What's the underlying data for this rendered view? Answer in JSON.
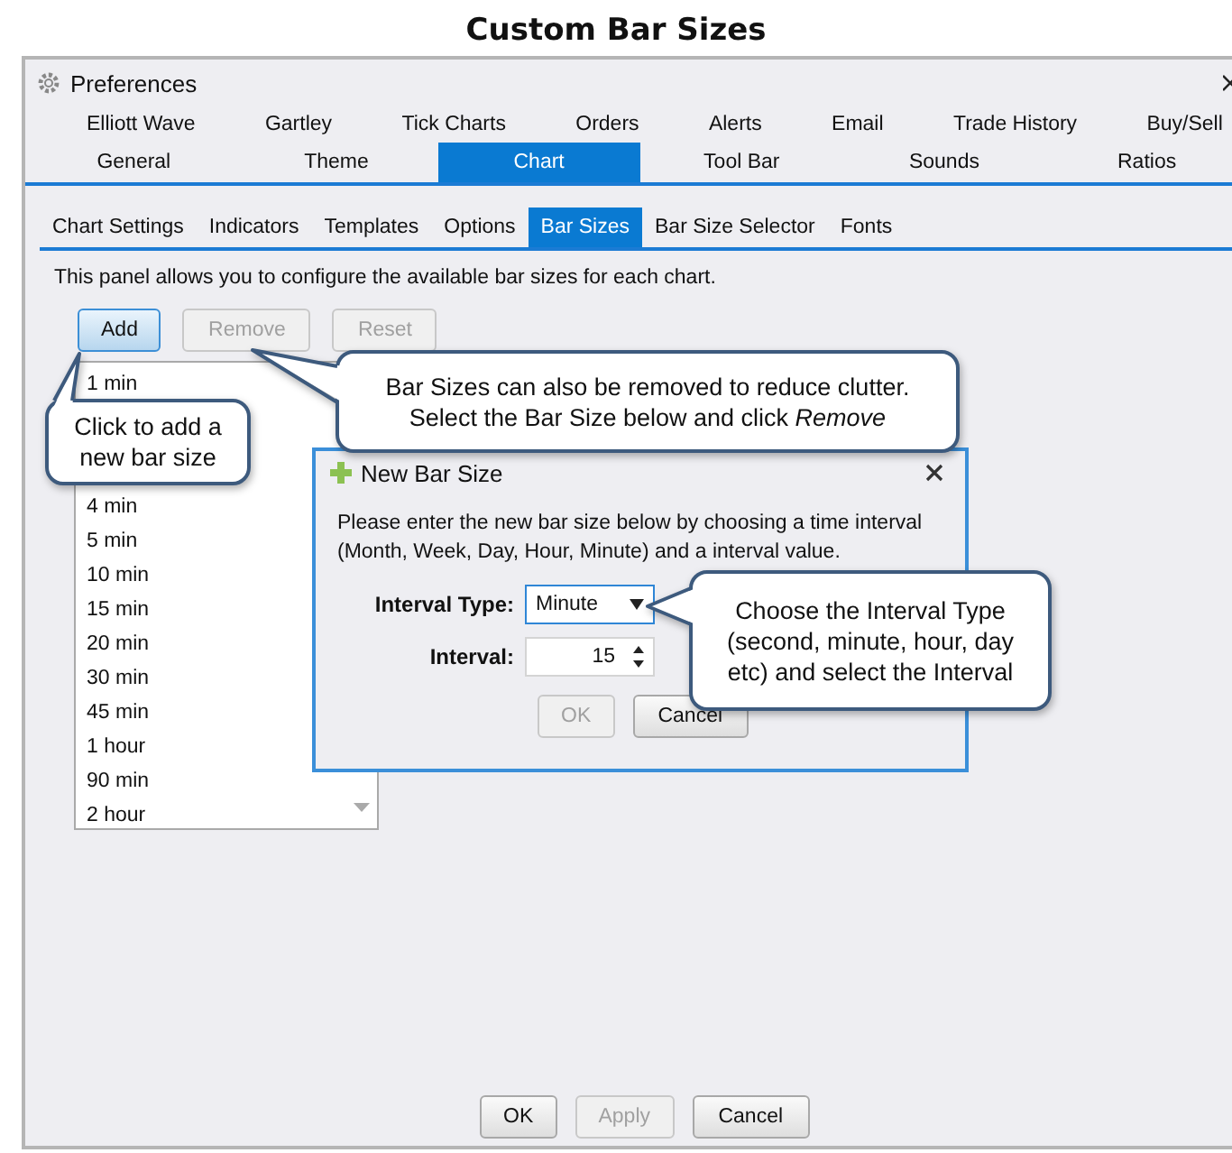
{
  "page_title": "Custom Bar Sizes",
  "window": {
    "title": "Preferences"
  },
  "tabs_row_1": [
    {
      "label": "Elliott Wave",
      "selected": false
    },
    {
      "label": "Gartley",
      "selected": false
    },
    {
      "label": "Tick Charts",
      "selected": false
    },
    {
      "label": "Orders",
      "selected": false
    },
    {
      "label": "Alerts",
      "selected": false
    },
    {
      "label": "Email",
      "selected": false
    },
    {
      "label": "Trade History",
      "selected": false
    },
    {
      "label": "Buy/Sell",
      "selected": false
    }
  ],
  "tabs_row_2": [
    {
      "label": "General",
      "selected": false
    },
    {
      "label": "Theme",
      "selected": false
    },
    {
      "label": "Chart",
      "selected": true
    },
    {
      "label": "Tool Bar",
      "selected": false
    },
    {
      "label": "Sounds",
      "selected": false
    },
    {
      "label": "Ratios",
      "selected": false
    }
  ],
  "subtabs": [
    {
      "label": "Chart Settings",
      "selected": false
    },
    {
      "label": "Indicators",
      "selected": false
    },
    {
      "label": "Templates",
      "selected": false
    },
    {
      "label": "Options",
      "selected": false
    },
    {
      "label": "Bar Sizes",
      "selected": true
    },
    {
      "label": "Bar Size Selector",
      "selected": false
    },
    {
      "label": "Fonts",
      "selected": false
    }
  ],
  "description": "This panel allows you to configure the available bar sizes for each chart.",
  "buttons": [
    {
      "label": "Add",
      "disabled": false,
      "focused": true
    },
    {
      "label": "Remove",
      "disabled": true,
      "focused": false
    },
    {
      "label": "Reset",
      "disabled": true,
      "focused": false
    }
  ],
  "bar_sizes": [
    "1 min",
    "4 min",
    "5 min",
    "10 min",
    "15 min",
    "20 min",
    "30 min",
    "45 min",
    "1 hour",
    "90 min",
    "2 hour"
  ],
  "dialog": {
    "title": "New Bar Size",
    "text": "Please enter the new bar size below by choosing a time interval (Month, Week, Day, Hour, Minute) and a interval value.",
    "fields": [
      {
        "kind": "select",
        "label": "Interval Type:",
        "value": "Minute",
        "focused": true
      },
      {
        "kind": "spinner",
        "label": "Interval:",
        "value": "15",
        "focused": false
      }
    ],
    "buttons": [
      {
        "label": "OK",
        "disabled": true
      },
      {
        "label": "Cancel",
        "disabled": false
      }
    ]
  },
  "callouts": [
    {
      "text": "Click to add a\nnew bar size"
    },
    {
      "text": "Bar Sizes can also be removed to reduce clutter.\nSelect the Bar Size below and click *Remove*"
    },
    {
      "text": "Choose the Interval Type\n(second, minute, hour, day\netc) and select the Interval"
    }
  ],
  "footer_buttons": [
    {
      "label": "OK",
      "disabled": false
    },
    {
      "label": "Apply",
      "disabled": true
    },
    {
      "label": "Cancel",
      "disabled": false
    }
  ]
}
